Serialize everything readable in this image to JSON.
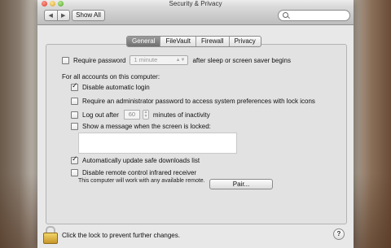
{
  "window": {
    "title": "Security & Privacy"
  },
  "toolbar": {
    "back_glyph": "◀",
    "forward_glyph": "▶",
    "show_all_label": "Show All",
    "search_value": ""
  },
  "tabs": [
    {
      "label": "General",
      "active": true
    },
    {
      "label": "FileVault",
      "active": false
    },
    {
      "label": "Firewall",
      "active": false
    },
    {
      "label": "Privacy",
      "active": false
    }
  ],
  "general": {
    "require_password": {
      "label": "Require password",
      "checked": false,
      "interval": "1 minute",
      "suffix": "after sleep or screen saver begins"
    },
    "all_accounts_label": "For all accounts on this computer:",
    "disable_auto_login": {
      "label": "Disable automatic login",
      "checked": true
    },
    "require_admin": {
      "label": "Require an administrator password to access system preferences with lock icons",
      "checked": false
    },
    "log_out": {
      "label": "Log out after",
      "minutes": "60",
      "suffix": "minutes of inactivity",
      "checked": false
    },
    "show_message": {
      "label": "Show a message when the screen is locked:",
      "checked": false,
      "message": ""
    },
    "auto_update": {
      "label": "Automatically update safe downloads list",
      "checked": true
    },
    "disable_remote": {
      "label": "Disable remote control infrared receiver",
      "checked": false
    },
    "remote_note": "This computer will work with any available remote.",
    "pair_label": "Pair..."
  },
  "footer": {
    "lock_text": "Click the lock to prevent further changes.",
    "help_glyph": "?"
  },
  "icons": {
    "lock": "lock-icon",
    "search": "search-icon"
  }
}
